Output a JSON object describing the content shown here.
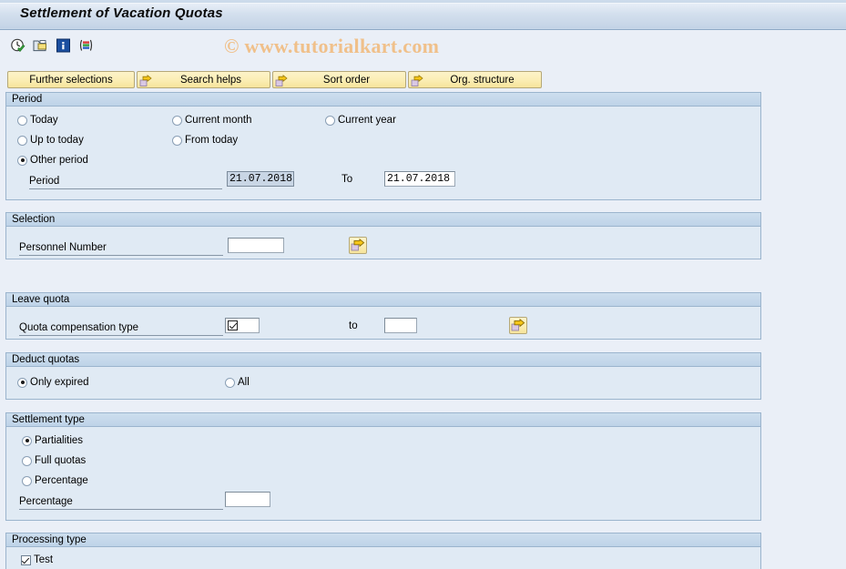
{
  "window": {
    "title": "Settlement of Vacation Quotas"
  },
  "watermark": "© www.tutorialkart.com",
  "toolbar": {
    "icons": [
      {
        "name": "execute-clock-icon",
        "title": "Execute"
      },
      {
        "name": "copy-variant-icon",
        "title": "Get Variant"
      },
      {
        "name": "info-icon",
        "title": "Information"
      },
      {
        "name": "multiple-selection-icon",
        "title": "Multiple Selection"
      }
    ]
  },
  "buttons": [
    {
      "label": "Further selections",
      "arrow": false
    },
    {
      "label": "Search helps",
      "arrow": true
    },
    {
      "label": "Sort order",
      "arrow": true
    },
    {
      "label": "Org. structure",
      "arrow": true
    }
  ],
  "period": {
    "header": "Period",
    "options": [
      {
        "label": "Today",
        "checked": false
      },
      {
        "label": "Current month",
        "checked": false
      },
      {
        "label": "Current year",
        "checked": false
      },
      {
        "label": "Up to today",
        "checked": false
      },
      {
        "label": "From today",
        "checked": false
      },
      {
        "label": "Other period",
        "checked": true
      }
    ],
    "period_label": "Period",
    "period_value": "21.07.2018",
    "to_label": "To",
    "to_value": "21.07.2018"
  },
  "selection": {
    "header": "Selection",
    "personnel_number_label": "Personnel Number",
    "personnel_number_value": "",
    "multi_select_title": "Multiple selection"
  },
  "leave_quota": {
    "header": "Leave quota",
    "compensation_label": "Quota compensation type",
    "compensation_value": "",
    "to_label": "to",
    "to_value": "",
    "multi_select_title": "Multiple selection"
  },
  "deduct_quotas": {
    "header": "Deduct quotas",
    "options": [
      {
        "label": "Only expired",
        "checked": true
      },
      {
        "label": "All",
        "checked": false
      }
    ]
  },
  "settlement_type": {
    "header": "Settlement type",
    "options": [
      {
        "label": "Partialities",
        "checked": true
      },
      {
        "label": "Full quotas",
        "checked": false
      },
      {
        "label": "Percentage",
        "checked": false
      }
    ],
    "percentage_label": "Percentage",
    "percentage_value": ""
  },
  "processing_type": {
    "header": "Processing type",
    "test_label": "Test",
    "test_checked": true
  },
  "colors": {
    "background": "#eaeff7",
    "panel": "#e0eaf4",
    "panel_header": "#c5d6e9",
    "border": "#9bb4cd",
    "button": "#fbeeb6",
    "watermark": "#f0c08a",
    "selected_field": "#c9d6e5"
  }
}
